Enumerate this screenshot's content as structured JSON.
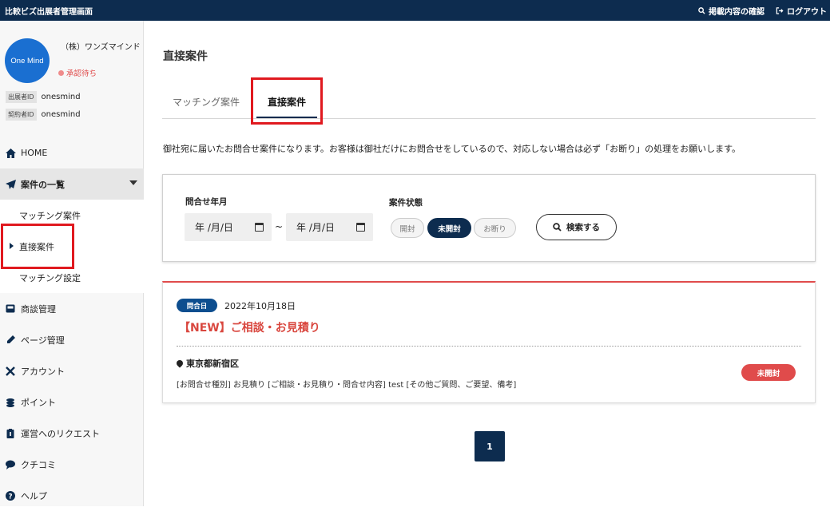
{
  "topbar": {
    "app_title": "比較ビズ出展者管理画面",
    "confirm_link": "掲載内容の確認",
    "logout_link": "ログアウト"
  },
  "company": {
    "logo_text": "One Mind",
    "name": "（株）ワンズマインド",
    "status": "承認待ち",
    "exhibitor_id_label": "出展者ID",
    "exhibitor_id": "onesmind",
    "contract_id_label": "契約者ID",
    "contract_id": "onesmind"
  },
  "nav": {
    "home": "HOME",
    "cases": "案件の一覧",
    "matching_cases": "マッチング案件",
    "direct_cases": "直接案件",
    "matching_settings": "マッチング設定",
    "negotiation": "商談管理",
    "page_mgmt": "ページ管理",
    "account": "アカウント",
    "points": "ポイント",
    "request": "運営へのリクエスト",
    "reviews": "クチコミ",
    "help": "ヘルプ"
  },
  "main": {
    "page_title": "直接案件",
    "tabs": [
      "マッチング案件",
      "直接案件"
    ],
    "description": "御社宛に届いたお問合せ案件になります。お客様は御社だけにお問合せをしているので、対応しない場合は必ず「お断り」の処理をお願いします。"
  },
  "search": {
    "date_label": "問合せ年月",
    "date_from": "年 /月/日",
    "date_to": "年 /月/日",
    "tilde": "~",
    "status_label": "案件状態",
    "status_options": [
      "開封",
      "未開封",
      "お断り"
    ],
    "selected_status": "未開封",
    "search_button": "検索する"
  },
  "case": {
    "date_label": "問合日",
    "date_value": "2022年10月18日",
    "title": "【NEW】ご相談・お見積り",
    "location": "東京都新宿区",
    "info": "[お問合せ種別] お見積り [ご相談・お見積り・問合せ内容] test [その他ご質問、ご要望、備考]",
    "status_badge": "未開封"
  },
  "pagination": {
    "current": "1"
  },
  "colors": {
    "navy": "#0d2c4f",
    "accent_red": "#e04b4b",
    "highlight_red": "#e0191f"
  }
}
